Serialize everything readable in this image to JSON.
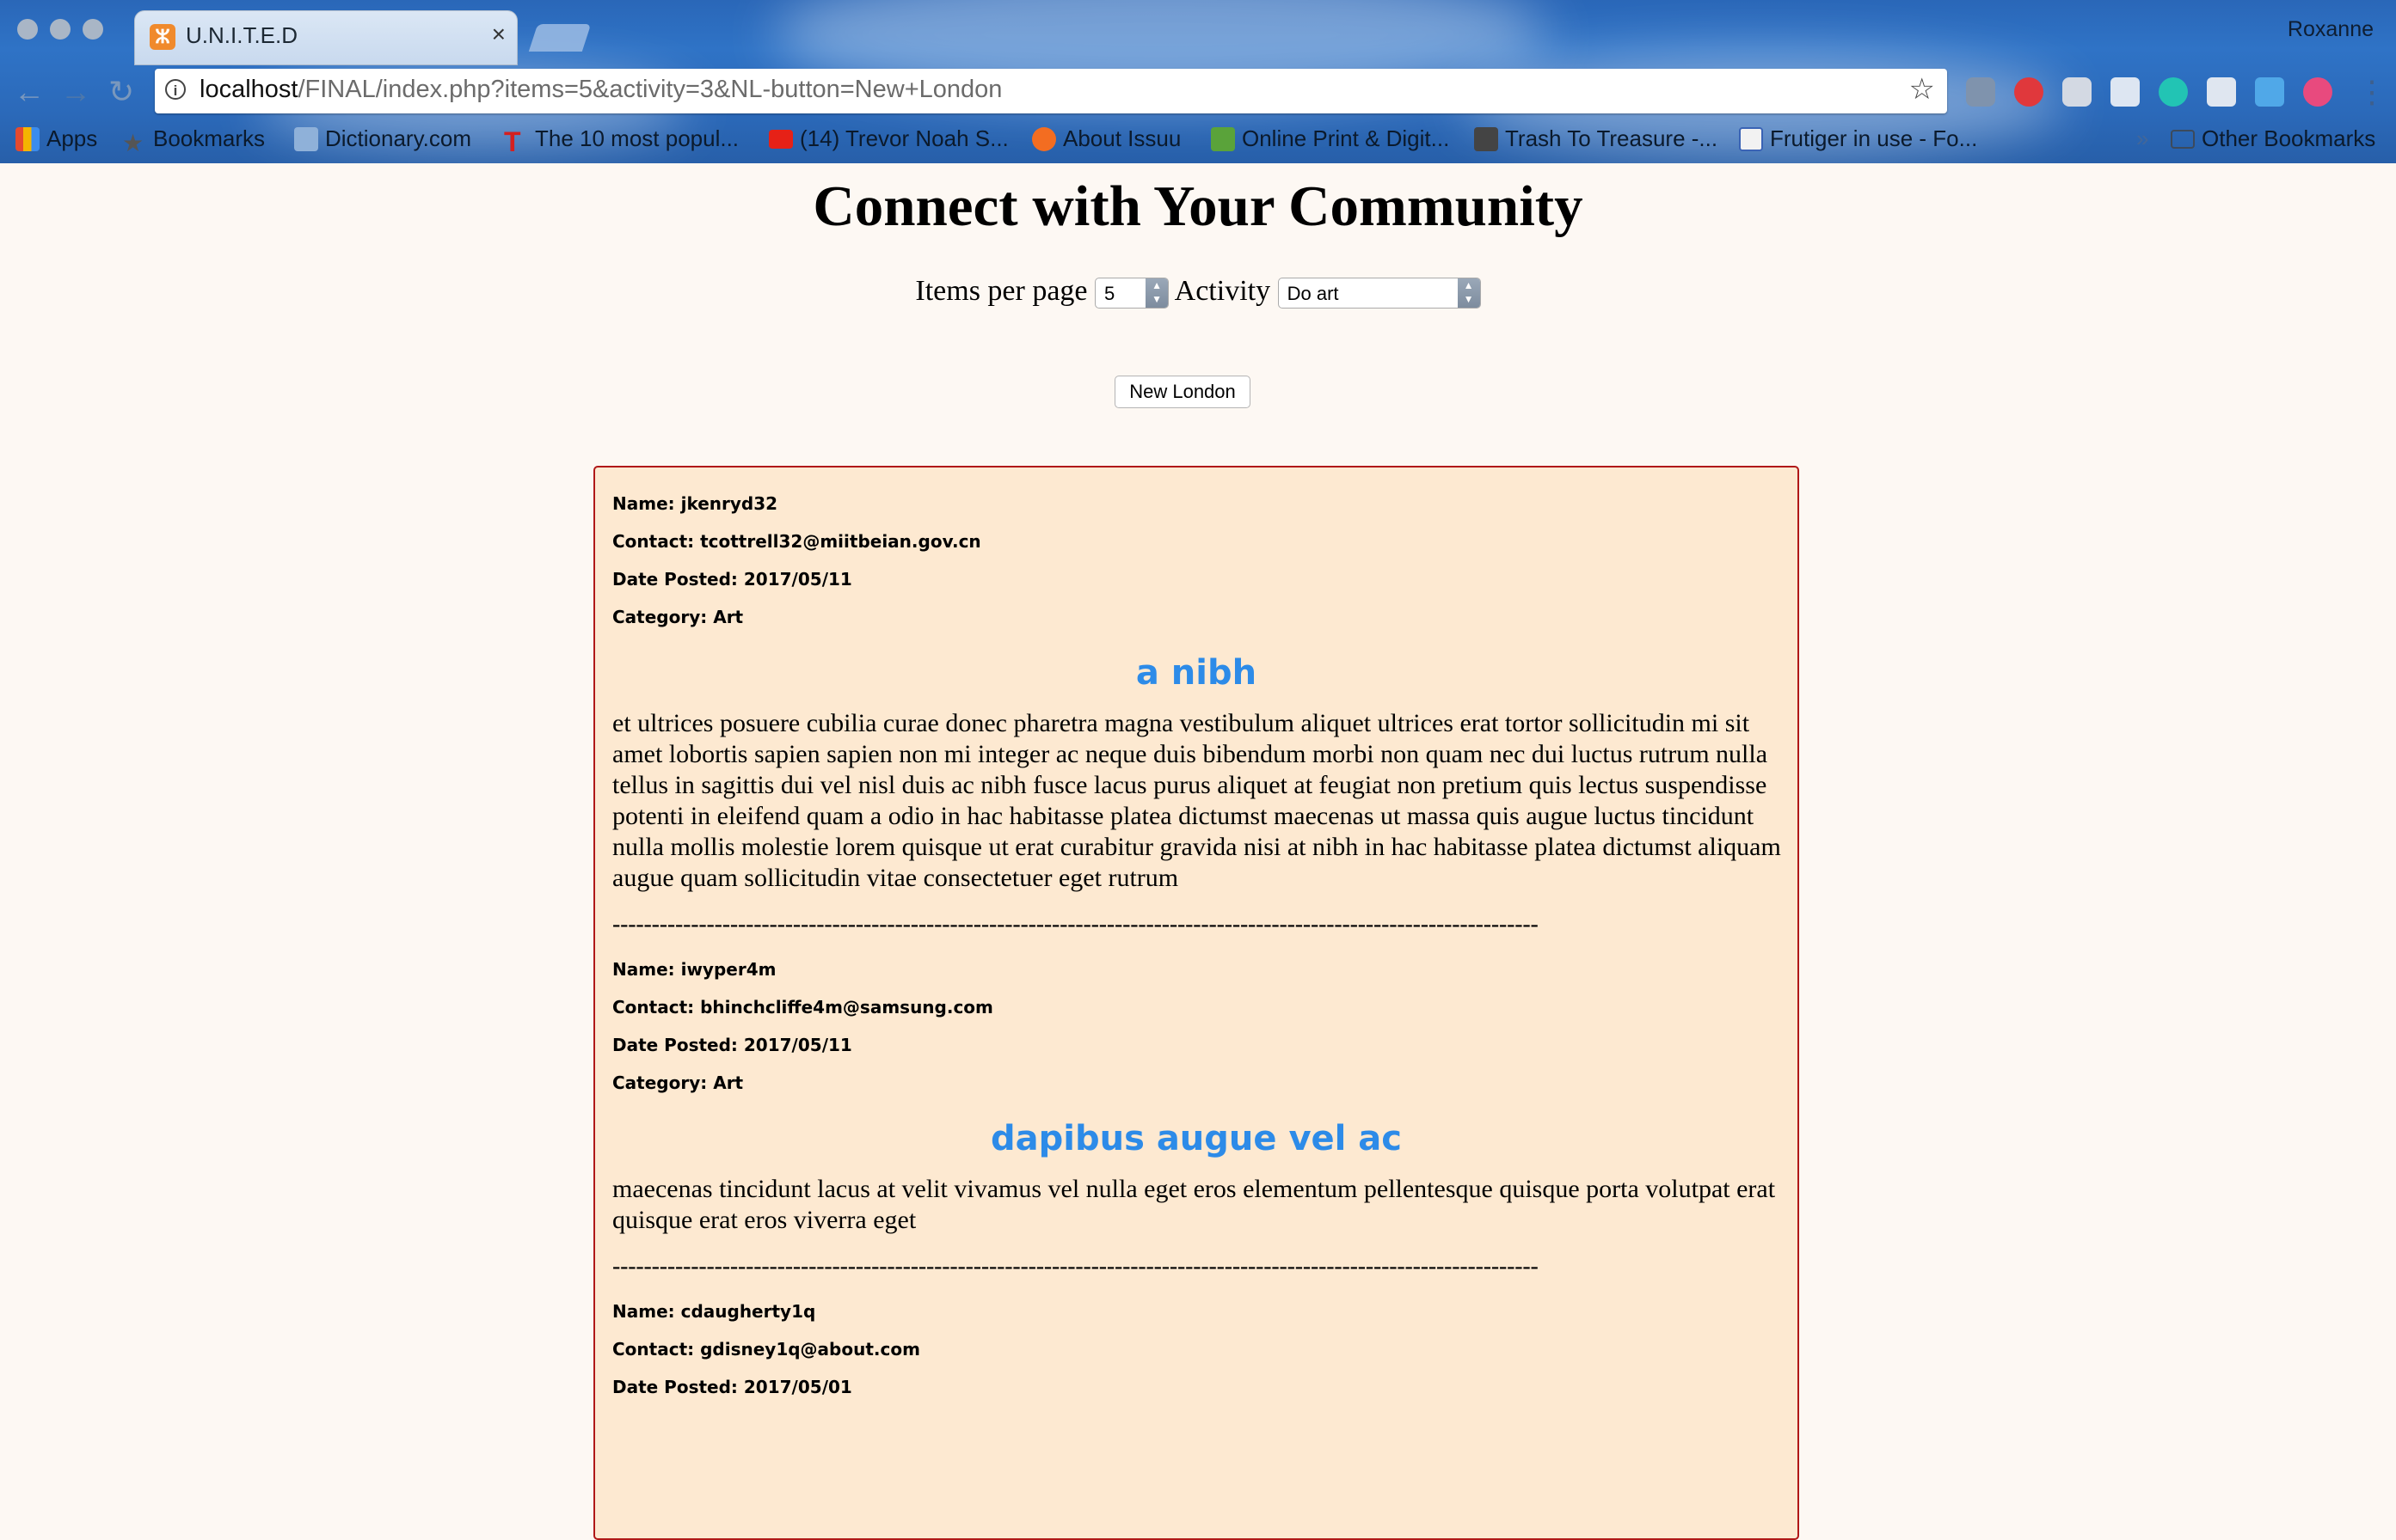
{
  "browser": {
    "tab_title": "U.N.I.T.E.D",
    "profile": "Roxanne",
    "url_host": "localhost",
    "url_path": "/FINAL/index.php?items=5&activity=3&NL-button=New+London",
    "bookmarks": [
      {
        "label": "Apps",
        "icon": "apps-grid-icon",
        "color": "#e54a2f"
      },
      {
        "label": "Bookmarks",
        "icon": "star-icon",
        "color": "#555555"
      },
      {
        "label": "Dictionary.com",
        "icon": "dictionary-icon",
        "color": "#4a78b0"
      },
      {
        "label": "The 10 most popul...",
        "icon": "t-logo-icon",
        "color": "#d42020"
      },
      {
        "label": "(14) Trevor Noah S...",
        "icon": "youtube-icon",
        "color": "#e62117"
      },
      {
        "label": "About Issuu",
        "icon": "issuu-icon",
        "color": "#f36d21"
      },
      {
        "label": "Online Print & Digit...",
        "icon": "print-icon",
        "color": "#5aa33a"
      },
      {
        "label": "Trash To Treasure -...",
        "icon": "trash-treasure-icon",
        "color": "#444444"
      },
      {
        "label": "Frutiger in use - Fo...",
        "icon": "fonts-in-use-icon",
        "color": "#3a63b5"
      }
    ],
    "overflow": "»",
    "other_bookmarks": "Other Bookmarks"
  },
  "page": {
    "title": "Connect with Your Community",
    "items_label": "Items per page",
    "items_value": "5",
    "activity_label": "Activity",
    "activity_value": "Do art",
    "button_label": "New London"
  },
  "posts": [
    {
      "name": "Name: jkenryd32",
      "contact": "Contact: tcottrell32@miitbeian.gov.cn",
      "date": "Date Posted: 2017/05/11",
      "category": "Category: Art",
      "title": "a nibh",
      "body": "et ultrices posuere cubilia curae donec pharetra magna vestibulum aliquet ultrices erat tortor sollicitudin mi sit amet lobortis sapien sapien non mi integer ac neque duis bibendum morbi non quam nec dui luctus rutrum nulla tellus in sagittis dui vel nisl duis ac nibh fusce lacus purus aliquet at feugiat non pretium quis lectus suspendisse potenti in eleifend quam a odio in hac habitasse platea dictumst maecenas ut massa quis augue luctus tincidunt nulla mollis molestie lorem quisque ut erat curabitur gravida nisi at nibh in hac habitasse platea dictumst aliquam augue quam sollicitudin vitae consectetuer eget rutrum",
      "separator": "----------------------------------------------------------------------------------------------------------------------"
    },
    {
      "name": "Name: iwyper4m",
      "contact": "Contact: bhinchcliffe4m@samsung.com",
      "date": "Date Posted: 2017/05/11",
      "category": "Category: Art",
      "title": "dapibus augue vel ac",
      "body": "maecenas tincidunt lacus at velit vivamus vel nulla eget eros elementum pellentesque quisque porta volutpat erat quisque erat eros viverra eget",
      "separator": "----------------------------------------------------------------------------------------------------------------------"
    },
    {
      "name": "Name: cdaugherty1q",
      "contact": "Contact: gdisney1q@about.com",
      "date": "Date Posted: 2017/05/01"
    }
  ]
}
